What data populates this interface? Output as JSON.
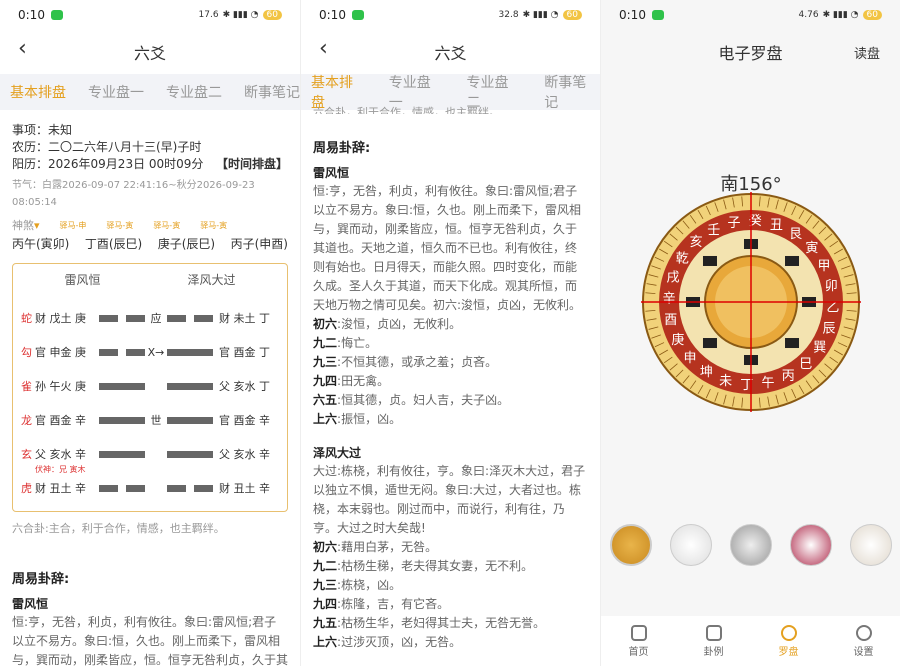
{
  "status": {
    "time": "0:10",
    "battery": "60",
    "net1": "17.6",
    "net2": "32.8",
    "net3": "4.76",
    "unit": "KB/s"
  },
  "p1": {
    "title": "六爻",
    "tabs": [
      "基本排盘",
      "专业盘一",
      "专业盘二",
      "断事笔记"
    ],
    "shixiang": "事项：未知",
    "nongli": "农历：二〇二六年八月十三(早)子时",
    "yangli": "阳历：2026年09月23日 00时09分",
    "time_btn": "【时间排盘】",
    "jieqi": "节气：白露2026-09-07 22:41:16~秋分2026-09-23 08:05:14",
    "shensha_label": "神煞",
    "shensha_items": [
      "驿马-申",
      "驿马-寅",
      "驿马-寅",
      "驿马-寅"
    ],
    "ganzhi": [
      "丙午(寅卯)",
      "丁酉(辰巳)",
      "庚子(辰巳)",
      "丙子(申酉)"
    ],
    "gua_names": [
      "雷风恒",
      "泽风大过"
    ],
    "yao": [
      {
        "shou": "蛇",
        "ben": "财 戊土 庚",
        "mark": "应",
        "bian": "财 未土 丁",
        "yin": true,
        "byin": true
      },
      {
        "shou": "勾",
        "ben": "官 申金 庚",
        "mark": "X→",
        "bian": "官 酉金 丁",
        "yin": true,
        "byin": false
      },
      {
        "shou": "雀",
        "ben": "孙 午火 庚",
        "mark": "",
        "bian": "父 亥水 丁",
        "yin": false,
        "byin": false
      },
      {
        "shou": "龙",
        "ben": "官 酉金 辛",
        "mark": "世",
        "bian": "官 酉金 辛",
        "yin": false,
        "byin": false
      },
      {
        "shou": "玄",
        "ben": "父 亥水 辛",
        "mark": "",
        "bian": "父 亥水 辛",
        "yin": false,
        "byin": false,
        "fushen": "伏神：兄 寅木"
      },
      {
        "shou": "虎",
        "ben": "财 丑土 辛",
        "mark": "",
        "bian": "财 丑土 辛",
        "yin": true,
        "byin": true
      }
    ],
    "liuhe": "六合卦:主合，利于合作，情感，也主羁绊。",
    "zhouyi_title": "周易卦辞:",
    "gua1_name": "雷风恒",
    "gua1_text": "恒:亨，无咎，利贞，利有攸往。象曰:雷风恒;君子以立不易方。象曰:恒，久也。刚上而柔下，雷风相与，巽而动，刚柔皆应，恒。恒亨无咎利贞，久于其道"
  },
  "p2": {
    "title": "六爻",
    "tabs": [
      "基本排盘",
      "专业盘一",
      "专业盘二",
      "断事笔记"
    ],
    "top_cut": "六合卦，利于合作，情感，也主羁绊。",
    "zhouyi_title": "周易卦辞:",
    "gua1_name": "雷风恒",
    "gua1_text": "恒:亨，无咎，利贞，利有攸往。象曰:雷风恒;君子以立不易方。象曰:恒，久也。刚上而柔下，雷风相与，巽而动，刚柔皆应，恒。恒亨无咎利贞，久于其道也。天地之道，恒久而不已也。利有攸往，终则有始也。日月得天，而能久照。四时变化，而能久成。圣人久于其道，而天下化成。观其所恒，而天地万物之情可见矣。初六:浚恒，贞凶，无攸利。",
    "gua1_lines": [
      [
        "初六",
        "浚恒，贞凶，无攸利。"
      ],
      [
        "九二",
        "悔亡。"
      ],
      [
        "九三",
        "不恒其德，或承之羞；贞吝。"
      ],
      [
        "九四",
        "田无禽。"
      ],
      [
        "六五",
        "恒其德，贞。妇人吉，夫子凶。"
      ],
      [
        "上六",
        "振恒，凶。"
      ]
    ],
    "gua2_name": "泽风大过",
    "gua2_text": "大过:栋桡，利有攸往，亨。象曰:泽灭木大过，君子以独立不惧，遁世无闷。象曰:大过，大者过也。栋桡，本末弱也。刚过而中，而说行，利有往，乃亨。大过之时大矣哉!",
    "gua2_lines": [
      [
        "初六",
        "藉用白茅，无咎。"
      ],
      [
        "九二",
        "枯杨生稊，老夫得其女妻，无不利。"
      ],
      [
        "九三",
        "栋桡，凶。"
      ],
      [
        "九四",
        "栋隆，吉，有它吝。"
      ],
      [
        "九五",
        "枯杨生华，老妇得其士夫，无咎无誉。"
      ],
      [
        "上六",
        "过涉灭顶，凶，无咎。"
      ]
    ]
  },
  "p3": {
    "title": "电子罗盘",
    "read_btn": "读盘",
    "direction": "南156°",
    "tabbar": [
      "首页",
      "卦例",
      "罗盘",
      "设置"
    ],
    "active_tab": "罗盘",
    "accent": "#e4a020",
    "ring_labels": [
      "丙",
      "午",
      "丁",
      "未",
      "坤",
      "申",
      "庚",
      "酉",
      "辛",
      "戌",
      "乾",
      "亥",
      "壬",
      "子",
      "癸",
      "丑",
      "艮",
      "寅",
      "甲",
      "卯",
      "乙",
      "辰",
      "巽",
      "巳"
    ]
  }
}
